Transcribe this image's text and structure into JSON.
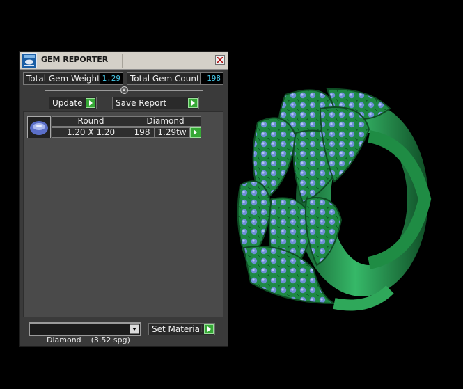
{
  "window": {
    "title": "GEM REPORTER"
  },
  "stats": {
    "total_weight_label": "Total Gem Weight",
    "total_weight_value": "1.29",
    "total_count_label": "Total Gem Count",
    "total_count_value": "198"
  },
  "toolbar": {
    "update_label": "Update",
    "save_report_label": "Save Report"
  },
  "gem_list": [
    {
      "shape": "Round",
      "material": "Diamond",
      "size": "1.20 X 1.20",
      "count": "198",
      "weight": "1.29tw"
    }
  ],
  "footer": {
    "material_select": "Diamond    (3.52 spg)",
    "set_material_label": "Set Material"
  },
  "colors": {
    "play_green": "#36a836",
    "value_cyan": "#48c8e8",
    "metal_green": "#2fa85a",
    "gem_blue": "#6f8fd8"
  },
  "icons": {
    "app": "gem-reporter-icon",
    "close": "close-icon",
    "play": "play-arrow-icon",
    "dropdown": "chevron-down-icon"
  }
}
